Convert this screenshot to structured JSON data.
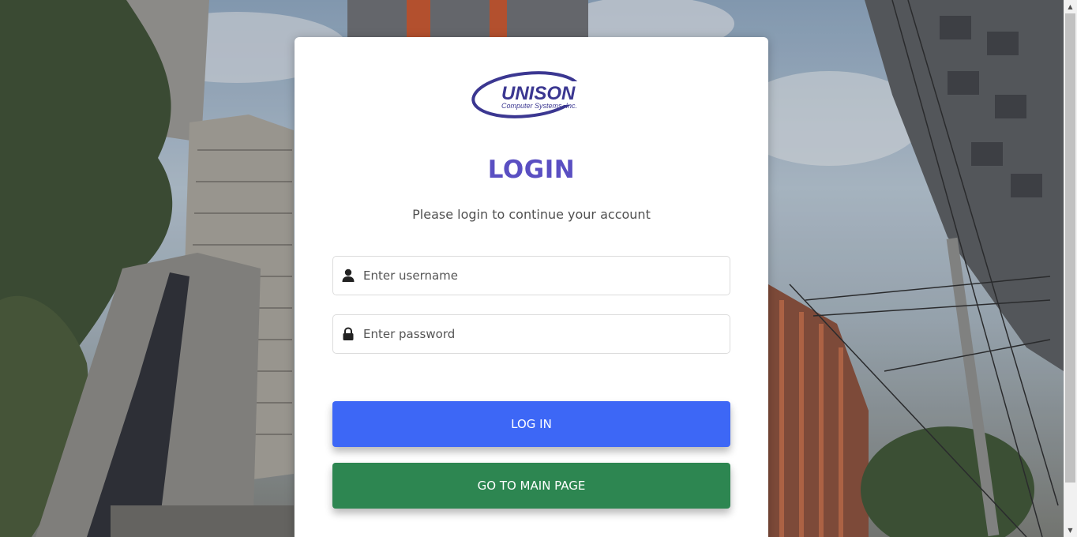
{
  "logo": {
    "brand": "UNISON",
    "tagline": "Computer Systems, Inc."
  },
  "login": {
    "title": "LOGIN",
    "subtitle": "Please login to continue your account",
    "username_placeholder": "Enter username",
    "password_placeholder": "Enter password",
    "login_button": "LOG IN",
    "main_page_button": "GO TO MAIN PAGE"
  },
  "icons": {
    "username": "user-icon",
    "password": "lock-icon"
  },
  "colors": {
    "title": "#5a4fc2",
    "login_button": "#3d67f6",
    "main_page_button": "#2d8651",
    "logo": "#3b3791"
  }
}
